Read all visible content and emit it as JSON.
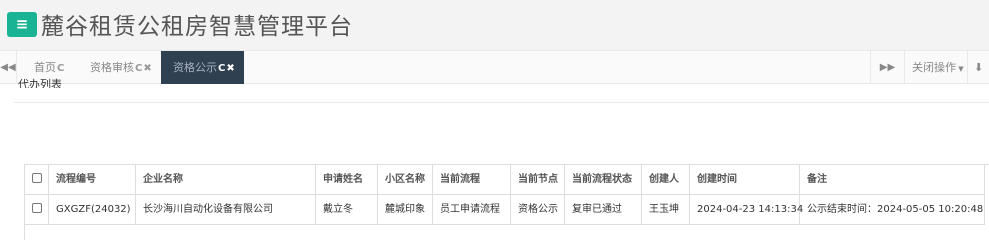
{
  "header": {
    "menu_icon": "bars-icon",
    "title": "麓谷租赁公租房智慧管理平台"
  },
  "tabs": [
    {
      "label": "首页",
      "refresh_icon": "C"
    },
    {
      "label": "资格审核",
      "refresh_icon": "C",
      "close_icon": "✖"
    },
    {
      "label": "资格公示",
      "refresh_icon": "C",
      "close_icon": "✖",
      "active": true
    }
  ],
  "tabbar": {
    "left_nav": "◀◀",
    "right_nav": "▶▶",
    "close_ops": "关闭操作",
    "refresh_icon": "⬇"
  },
  "section": {
    "title": "代办列表"
  },
  "table": {
    "columns": [
      "流程编号",
      "企业名称",
      "申请姓名",
      "小区名称",
      "当前流程",
      "当前节点",
      "当前流程状态",
      "创建人",
      "创建时间",
      "备注"
    ],
    "rows": [
      [
        "GXGZF(24032)",
        "长沙海川自动化设备有限公司",
        "戴立冬",
        "麓城印象",
        "员工申请流程",
        "资格公示",
        "复审已通过",
        "王玉坤",
        "2024-04-23 14:13:34",
        "公示结束时间：2024-05-05 10:20:48"
      ]
    ]
  },
  "colors": {
    "accent": "#1ab394",
    "active_tab_bg": "#2f4050"
  }
}
